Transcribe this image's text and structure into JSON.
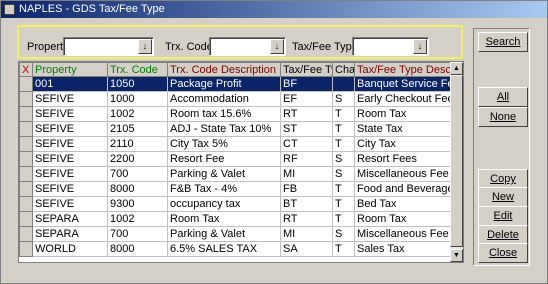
{
  "window": {
    "title": "NAPLES - GDS Tax/Fee Type"
  },
  "filters": {
    "property_label": "Property",
    "property_value": "",
    "trx_code_label": "Trx. Code",
    "trx_code_value": "",
    "tax_fee_type_label": "Tax/Fee Type",
    "tax_fee_type_value": "",
    "dropdown_glyph": "↓"
  },
  "grid": {
    "columns": [
      "X",
      "Property",
      "Trx. Code",
      "Trx. Code Description",
      "Tax/Fee Type",
      "Charge",
      "Tax/Fee Type Description"
    ],
    "selected_row": 0,
    "rows": [
      [
        "",
        "001",
        "1050",
        "Package Profit",
        "BF",
        "",
        "Banquet Service Fee"
      ],
      [
        "",
        "SEFIVE",
        "1000",
        "Accommodation",
        "EF",
        "S",
        "Early Checkout Fee"
      ],
      [
        "",
        "SEFIVE",
        "1002",
        "Room tax 15.6%",
        "RT",
        "T",
        "Room Tax"
      ],
      [
        "",
        "SEFIVE",
        "2105",
        "ADJ - State Tax 10%",
        "ST",
        "T",
        "State Tax"
      ],
      [
        "",
        "SEFIVE",
        "2110",
        "City Tax 5%",
        "CT",
        "T",
        "City Tax"
      ],
      [
        "",
        "SEFIVE",
        "2200",
        "Resort Fee",
        "RF",
        "S",
        "Resort Fees"
      ],
      [
        "",
        "SEFIVE",
        "700",
        "Parking & Valet",
        "MI",
        "S",
        "Miscellaneous Fee"
      ],
      [
        "",
        "SEFIVE",
        "8000",
        "F&B Tax - 4%",
        "FB",
        "T",
        "Food and Beverage Tax"
      ],
      [
        "",
        "SEFIVE",
        "9300",
        "occupancy tax",
        "BT",
        "T",
        "Bed Tax"
      ],
      [
        "",
        "SEPARA",
        "1002",
        "Room Tax",
        "RT",
        "T",
        "Room Tax"
      ],
      [
        "",
        "SEPARA",
        "700",
        "Parking & Valet",
        "MI",
        "S",
        "Miscellaneous Fee"
      ],
      [
        "",
        "WORLD",
        "8000",
        "6.5% SALES TAX",
        "SA",
        "T",
        "Sales Tax"
      ]
    ]
  },
  "buttons": {
    "search": "Search",
    "all": "All",
    "none": "None",
    "copy": "Copy",
    "new": "New",
    "edit": "Edit",
    "delete": "Delete",
    "close": "Close"
  },
  "colors": {
    "title_bar": "#0a246a",
    "selection": "#0a246a",
    "header_green": "#008000",
    "header_red": "#c00000"
  }
}
